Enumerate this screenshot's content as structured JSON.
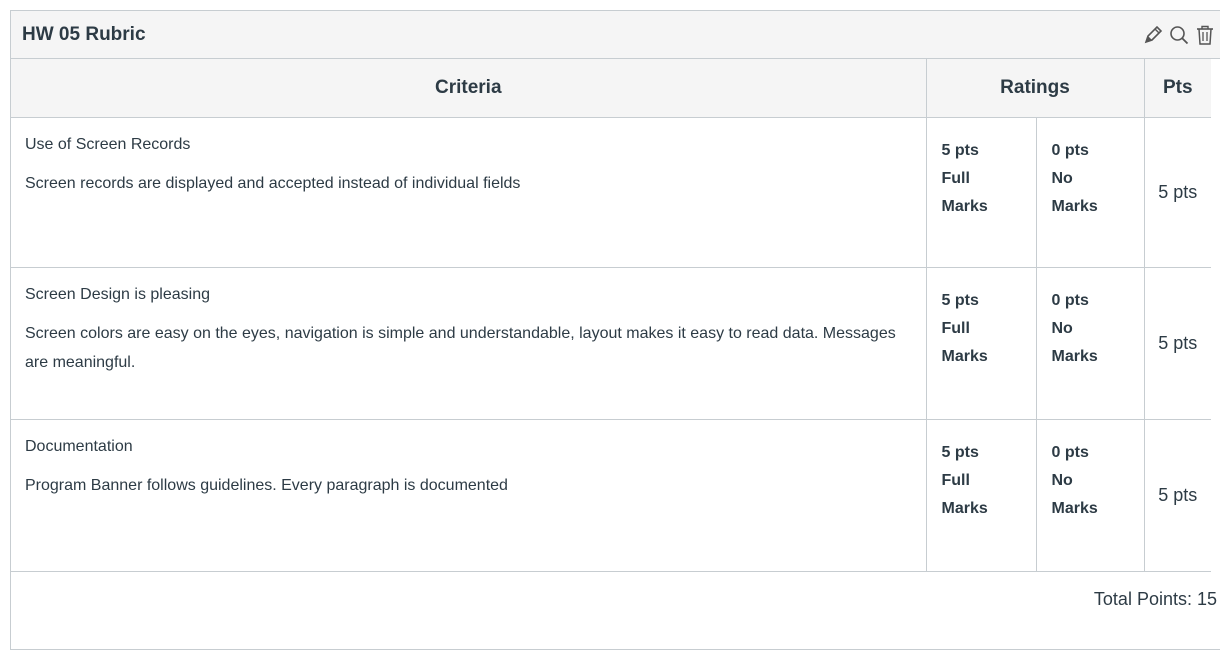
{
  "rubric": {
    "title": "HW 05 Rubric",
    "icons": {
      "edit": "pencil-icon",
      "search": "search-icon",
      "delete": "trash-icon"
    }
  },
  "table": {
    "headers": {
      "criteria": "Criteria",
      "ratings": "Ratings",
      "pts": "Pts"
    },
    "rows": [
      {
        "name": "Use of Screen Records",
        "description": "Screen records are displayed and accepted instead of individual fields",
        "rating_a": {
          "pts": "5 pts",
          "line1": "Full",
          "line2": "Marks"
        },
        "rating_b": {
          "pts": "0 pts",
          "line1": "No",
          "line2": "Marks"
        },
        "points": "5 pts"
      },
      {
        "name": "Screen Design is pleasing",
        "description": "Screen colors are easy on the eyes, navigation is simple and understandable, layout makes it easy to read data. Messages are meaningful.",
        "rating_a": {
          "pts": "5 pts",
          "line1": "Full",
          "line2": "Marks"
        },
        "rating_b": {
          "pts": "0 pts",
          "line1": "No",
          "line2": "Marks"
        },
        "points": "5 pts"
      },
      {
        "name": "Documentation",
        "description": "Program Banner follows guidelines. Every paragraph is documented",
        "rating_a": {
          "pts": "5 pts",
          "line1": "Full",
          "line2": "Marks"
        },
        "rating_b": {
          "pts": "0 pts",
          "line1": "No",
          "line2": "Marks"
        },
        "points": "5 pts"
      }
    ],
    "total": "Total Points: 15"
  }
}
